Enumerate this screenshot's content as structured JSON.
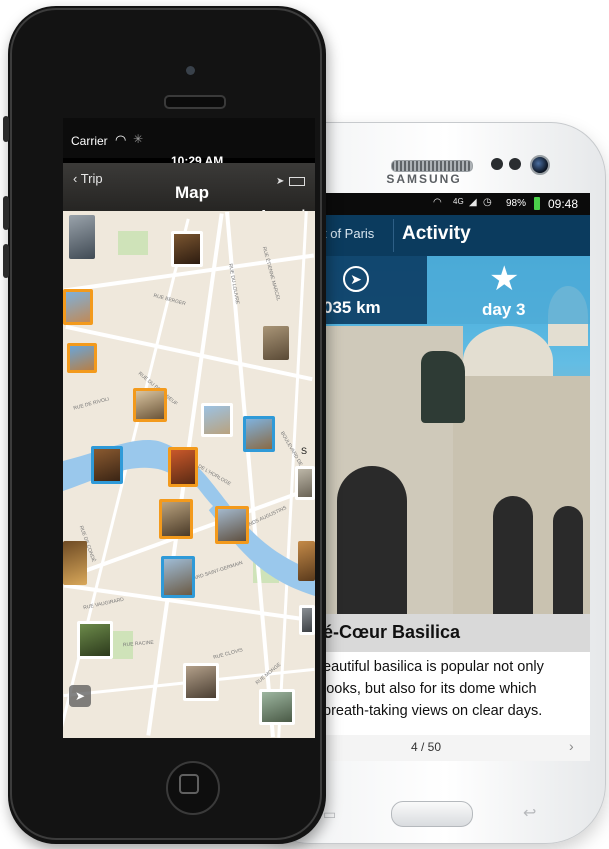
{
  "samsung": {
    "brand": "SAMSUNG",
    "status": {
      "network": "4G",
      "battery": "98%",
      "time": "09:48"
    },
    "header": {
      "back_title": "t of Paris",
      "title": "Activity"
    },
    "stats": {
      "distance": "035 km",
      "day": "day 3"
    },
    "place_name": "é-Cœur Basilica",
    "description_lines": [
      "eautiful basilica is popular not only",
      "looks, but also for its dome which",
      "breath-taking views on clear days."
    ],
    "pager": {
      "label": "4 / 50",
      "next": "›"
    }
  },
  "iphone": {
    "status": {
      "carrier": "Carrier",
      "time": "10:29 AM"
    },
    "navbar": {
      "back": "‹ Trip",
      "title": "Map",
      "around": "Around"
    },
    "map_labels": [
      "RUE BERGER",
      "RUE DU LOUVRE",
      "RUE DE RIVOLI",
      "RUE ÉTIENNE MARCEL",
      "QUAI DE L'HORLOGE",
      "BOULEVARD SAINT-GERMAIN",
      "RUE DE CONDÉ",
      "RUE MONGE",
      "RUE DU PONT NEUF",
      "RUE VAUGIRARD",
      "RUE RACINE",
      "RUE CLOVIS",
      "BOULEVARD DE SÉBASTOPOL",
      "QUAI DES GRANDS AUGUSTINS",
      "S"
    ]
  }
}
